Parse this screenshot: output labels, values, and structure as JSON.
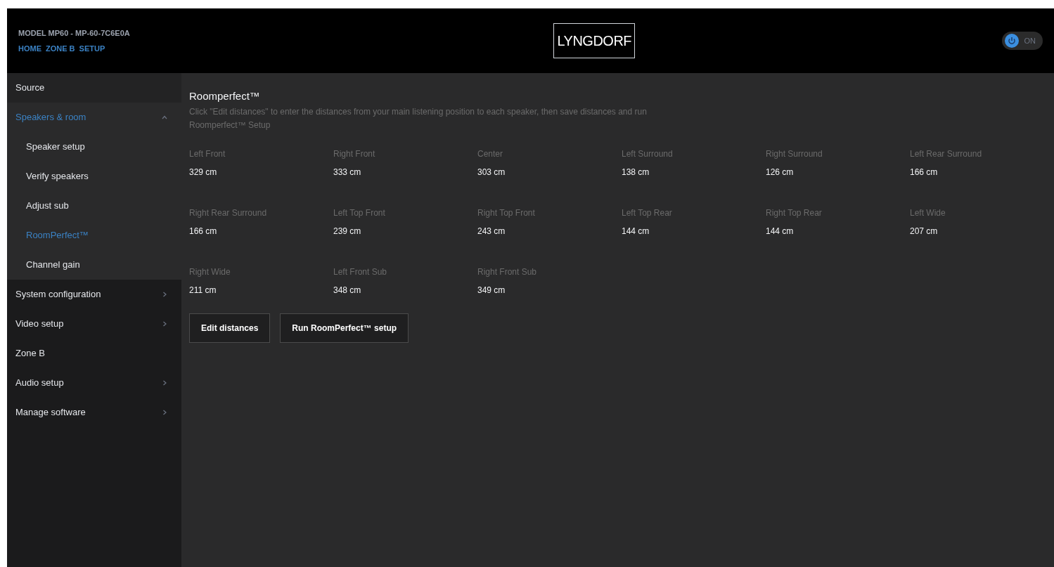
{
  "header": {
    "model": "MODEL MP60 - MP-60-7C6E0A",
    "breadcrumbs": [
      "HOME",
      "ZONE B",
      "SETUP"
    ],
    "logo": "LYNGDORF",
    "power": {
      "label": "ON",
      "on": true
    }
  },
  "sidebar": {
    "items": [
      {
        "label": "Source",
        "kind": "plain",
        "selected": false
      },
      {
        "label": "Speakers & room",
        "kind": "group",
        "expanded": true,
        "selected": true,
        "children": [
          {
            "label": "Speaker setup",
            "selected": false
          },
          {
            "label": "Verify speakers",
            "selected": false
          },
          {
            "label": "Adjust sub",
            "selected": false
          },
          {
            "label": "RoomPerfect™",
            "selected": true
          },
          {
            "label": "Channel gain",
            "selected": false
          }
        ]
      },
      {
        "label": "System configuration",
        "kind": "group",
        "expanded": false,
        "selected": false
      },
      {
        "label": "Video setup",
        "kind": "group",
        "expanded": false,
        "selected": false
      },
      {
        "label": "Zone B",
        "kind": "plain",
        "selected": false
      },
      {
        "label": "Audio setup",
        "kind": "group",
        "expanded": false,
        "selected": false
      },
      {
        "label": "Manage software",
        "kind": "group",
        "expanded": false,
        "selected": false
      }
    ]
  },
  "main": {
    "title": "Roomperfect™",
    "description": "Click \"Edit distances\" to enter the distances from your main listening position to each speaker, then save distances and run Roomperfect™ Setup",
    "distances": [
      {
        "label": "Left Front",
        "value": "329 cm"
      },
      {
        "label": "Right Front",
        "value": "333 cm"
      },
      {
        "label": "Center",
        "value": "303 cm"
      },
      {
        "label": "Left Surround",
        "value": "138 cm"
      },
      {
        "label": "Right Surround",
        "value": "126 cm"
      },
      {
        "label": "Left Rear Surround",
        "value": "166 cm"
      },
      {
        "label": "Right Rear Surround",
        "value": "166 cm"
      },
      {
        "label": "Left Top Front",
        "value": "239 cm"
      },
      {
        "label": "Right Top Front",
        "value": "243 cm"
      },
      {
        "label": "Left Top Rear",
        "value": "144 cm"
      },
      {
        "label": "Right Top Rear",
        "value": "144 cm"
      },
      {
        "label": "Left Wide",
        "value": "207 cm"
      },
      {
        "label": "Right Wide",
        "value": "211 cm"
      },
      {
        "label": "Left Front Sub",
        "value": "348 cm"
      },
      {
        "label": "Right Front Sub",
        "value": "349 cm"
      }
    ],
    "buttons": [
      "Edit distances",
      "Run RoomPerfect™ setup"
    ]
  }
}
